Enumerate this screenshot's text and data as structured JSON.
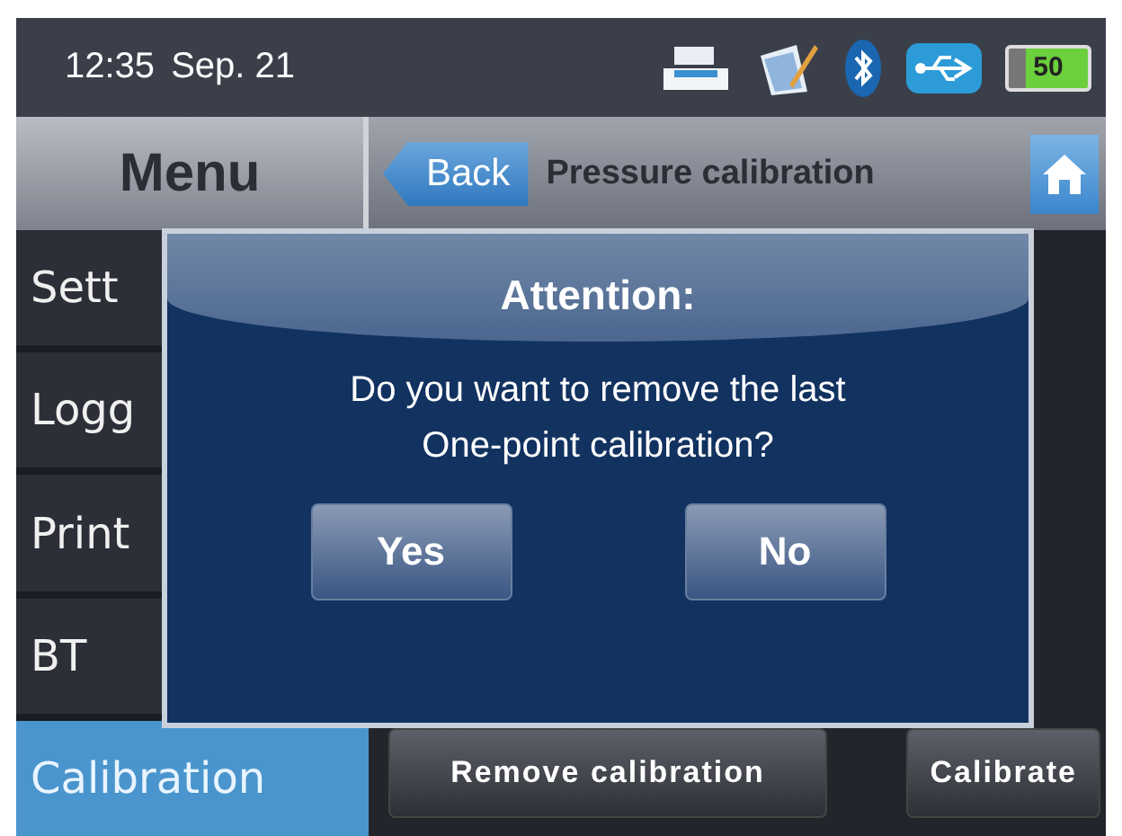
{
  "status_bar": {
    "time": "12:35",
    "date": "Sep. 21",
    "battery": "50"
  },
  "header": {
    "menu_title": "Menu",
    "back_button": "Back",
    "title": "Pressure calibration"
  },
  "menu": [
    {
      "label": "Sett",
      "selected": false
    },
    {
      "label": "Logg",
      "selected": false
    },
    {
      "label": "Print",
      "selected": false
    },
    {
      "label": "BT",
      "selected": false
    },
    {
      "label": "Calibration",
      "selected": true
    }
  ],
  "actions": [
    "Remove calibration",
    "Calibrate"
  ],
  "dialog": {
    "title": "Attention:",
    "message": "Do you want to remove the last\nOne-point calibration?",
    "buttons": [
      "Yes",
      "No"
    ]
  }
}
